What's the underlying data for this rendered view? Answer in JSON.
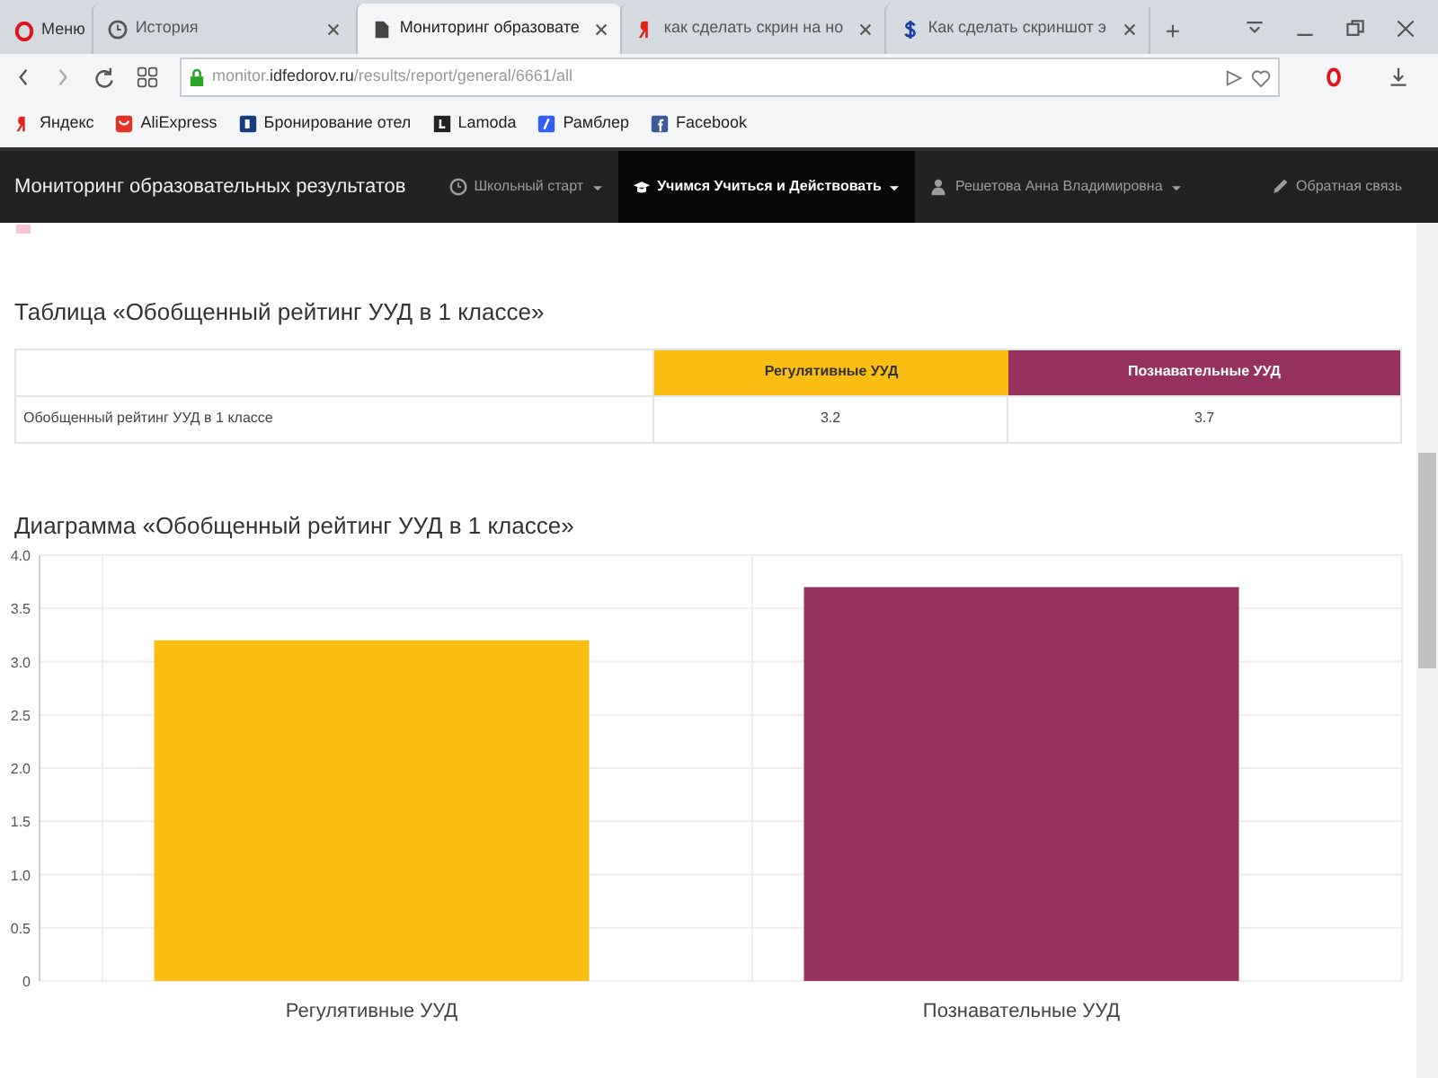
{
  "browser": {
    "menu_label": "Меню",
    "tabs": [
      {
        "label": "История",
        "selected": false
      },
      {
        "label": "Мониторинг образовате",
        "selected": true
      },
      {
        "label": "как сделать скрин на но",
        "selected": false
      },
      {
        "label": "Как сделать скриншот э",
        "selected": false
      }
    ],
    "new_tab": "+",
    "address": [
      {
        "text": "monitor.",
        "emphasis": false
      },
      {
        "text": "idfedorov.ru",
        "emphasis": true
      },
      {
        "text": "/results/report/general/6661/all",
        "emphasis": false
      }
    ],
    "bookmarks": [
      {
        "label": "Яндекс"
      },
      {
        "label": "AliExpress"
      },
      {
        "label": "Бронирование отел"
      },
      {
        "label": "Lamoda"
      },
      {
        "label": "Рамблер"
      },
      {
        "label": "Facebook"
      }
    ]
  },
  "navbar": {
    "brand": "Мониторинг образовательных результатов",
    "items": [
      {
        "label": "Школьный старт",
        "kind": "dropdown",
        "selected": false
      },
      {
        "label": "Учимся Учиться и Действовать",
        "kind": "dropdown",
        "selected": true
      },
      {
        "label": "Решетова Анна Владимировна",
        "kind": "dropdown",
        "selected": false
      },
      {
        "label": "Обратная связь",
        "kind": "link"
      }
    ]
  },
  "table": {
    "title": "Таблица «Обобщенный рейтинг УУД в 1 классе»",
    "columns": [
      {
        "label": "Регулятивные УУД",
        "color": "#fdbe14"
      },
      {
        "label": "Познавательные УУД",
        "color": "#963260"
      }
    ],
    "rows": [
      {
        "label": "Обобщенный рейтинг УУД в 1 классе",
        "values": [
          "3.2",
          "3.7"
        ]
      }
    ]
  },
  "chart": {
    "title": "Диаграмма «Обобщенный рейтинг УУД в 1 классе»",
    "chart_data": {
      "type": "bar",
      "grid": true,
      "categories": [
        "Регулятивные УУД",
        "Познавательные УУД"
      ],
      "values": [
        3.2,
        3.7
      ],
      "ylim": [
        0,
        4
      ],
      "yticks": [
        {
          "value": 0,
          "label": "0"
        },
        {
          "value": 0.5,
          "label": "0.5"
        },
        {
          "value": 1,
          "label": "1.0"
        },
        {
          "value": 1.5,
          "label": "1.5"
        },
        {
          "value": 2,
          "label": "2.0"
        },
        {
          "value": 2.5,
          "label": "2.5"
        },
        {
          "value": 3,
          "label": "3.0"
        },
        {
          "value": 3.5,
          "label": "3.5"
        },
        {
          "value": 4,
          "label": "4.0"
        }
      ]
    }
  }
}
